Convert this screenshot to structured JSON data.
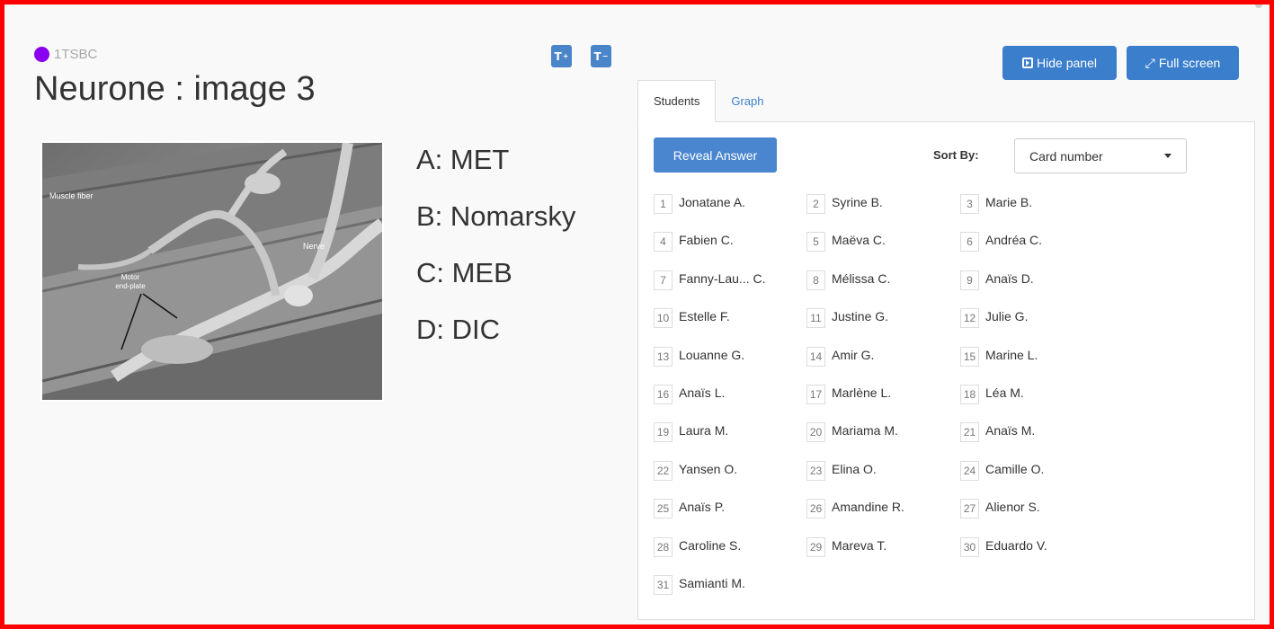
{
  "left_panel": {
    "class_name": "1TSBC",
    "class_color": "#8a00f0",
    "title": "Neurone : image 3",
    "text_increase_label": "T",
    "text_decrease_label": "T",
    "image": {
      "labels": {
        "muscle": "Muscle fiber",
        "nerve": "Nerve",
        "motor_1": "Motor",
        "motor_2": "end-plate"
      }
    },
    "answers": [
      "A: MET",
      "B: Nomarsky",
      "C: MEB",
      "D: DIC"
    ]
  },
  "right_panel": {
    "hide_panel_label": "Hide panel",
    "full_screen_label": "Full screen",
    "tabs": [
      {
        "label": "Students",
        "active": true
      },
      {
        "label": "Graph",
        "active": false
      }
    ],
    "reveal_answer_label": "Reveal Answer",
    "sort_by_label": "Sort By:",
    "sort_value": "Card number",
    "accent_color": "#3b7fcc",
    "students": [
      {
        "num": "1",
        "name": "Jonatane A."
      },
      {
        "num": "2",
        "name": "Syrine B."
      },
      {
        "num": "3",
        "name": "Marie B."
      },
      {
        "num": "4",
        "name": "Fabien C."
      },
      {
        "num": "5",
        "name": "Maëva C."
      },
      {
        "num": "6",
        "name": "Andréa C."
      },
      {
        "num": "7",
        "name": "Fanny-Lau... C."
      },
      {
        "num": "8",
        "name": "Mélissa C."
      },
      {
        "num": "9",
        "name": "Anaïs D."
      },
      {
        "num": "10",
        "name": "Estelle F."
      },
      {
        "num": "11",
        "name": "Justine G."
      },
      {
        "num": "12",
        "name": "Julie G."
      },
      {
        "num": "13",
        "name": "Louanne G."
      },
      {
        "num": "14",
        "name": "Amir G."
      },
      {
        "num": "15",
        "name": "Marine L."
      },
      {
        "num": "16",
        "name": "Anaïs L."
      },
      {
        "num": "17",
        "name": "Marlène L."
      },
      {
        "num": "18",
        "name": "Léa M."
      },
      {
        "num": "19",
        "name": "Laura M."
      },
      {
        "num": "20",
        "name": "Mariama M."
      },
      {
        "num": "21",
        "name": "Anaïs M."
      },
      {
        "num": "22",
        "name": "Yansen O."
      },
      {
        "num": "23",
        "name": "Elina O."
      },
      {
        "num": "24",
        "name": "Camille O."
      },
      {
        "num": "25",
        "name": "Anaïs P."
      },
      {
        "num": "26",
        "name": "Amandine R."
      },
      {
        "num": "27",
        "name": "Alienor S."
      },
      {
        "num": "28",
        "name": "Caroline S."
      },
      {
        "num": "29",
        "name": "Mareva T."
      },
      {
        "num": "30",
        "name": "Eduardo V."
      },
      {
        "num": "31",
        "name": "Samianti M."
      }
    ]
  }
}
